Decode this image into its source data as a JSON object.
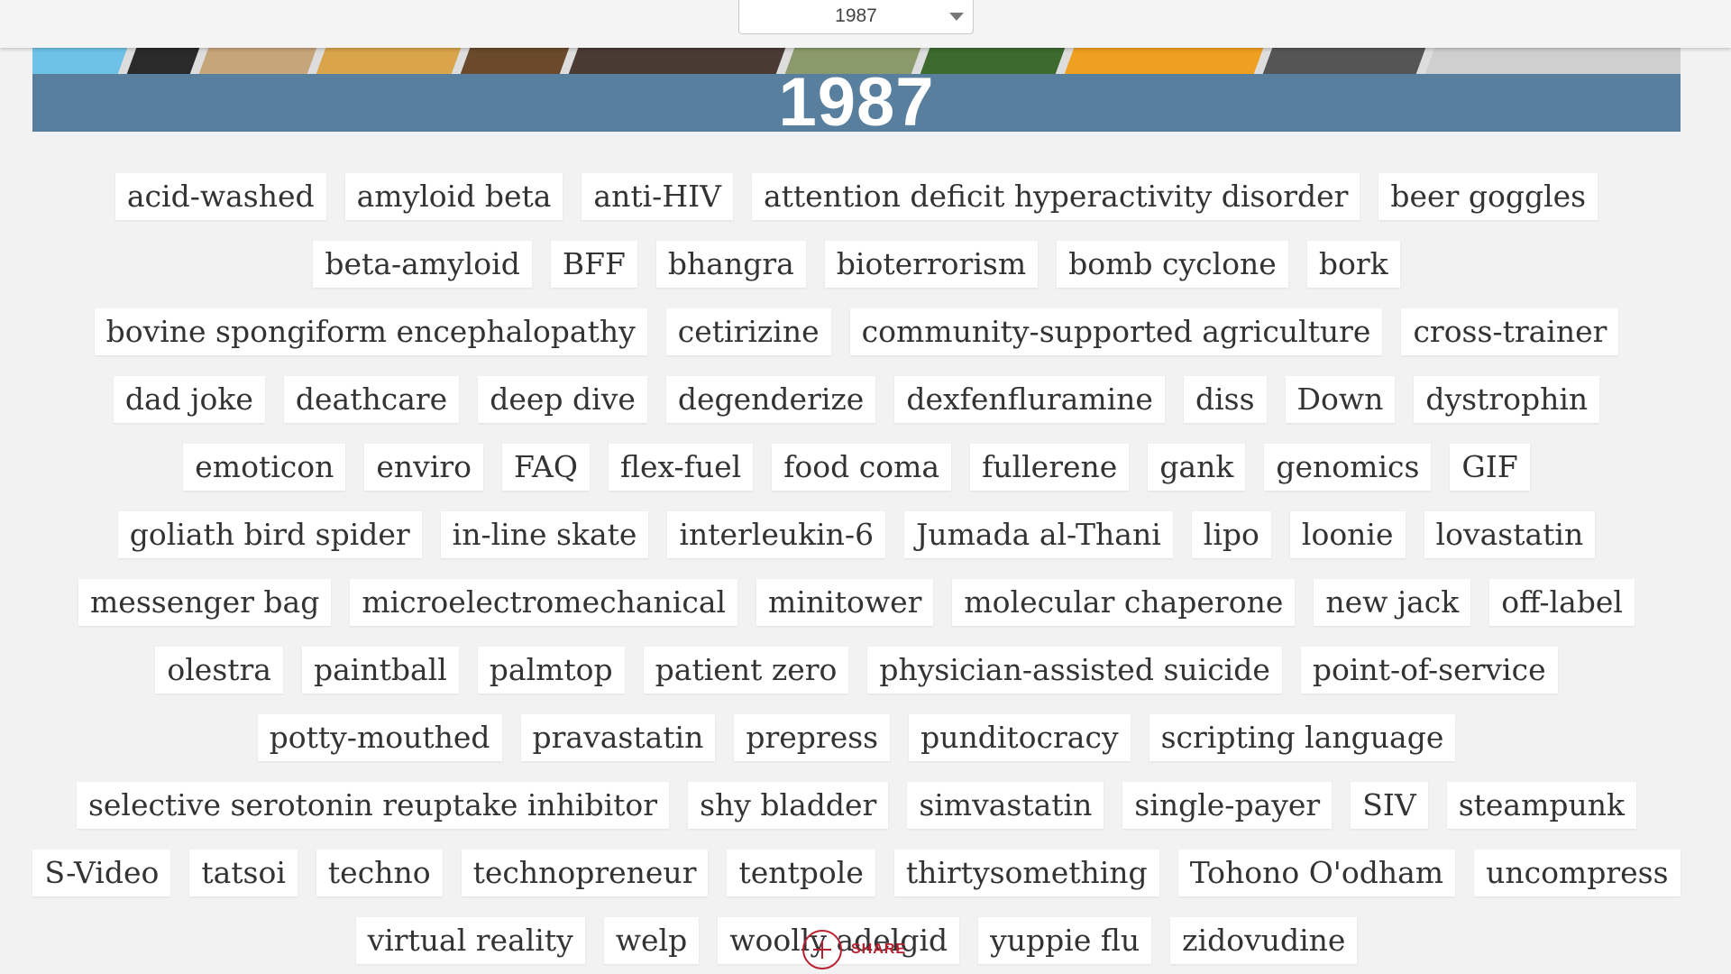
{
  "year_select": {
    "value": "1987"
  },
  "banner": {
    "year": "1987",
    "color": "#587f9e"
  },
  "words": [
    "acid-washed",
    "amyloid beta",
    "anti-HIV",
    "attention deficit hyperactivity disorder",
    "beer goggles",
    "beta-amyloid",
    "BFF",
    "bhangra",
    "bioterrorism",
    "bomb cyclone",
    "bork",
    "bovine spongiform encephalopathy",
    "cetirizine",
    "community-supported agriculture",
    "cross-trainer",
    "dad joke",
    "deathcare",
    "deep dive",
    "degenderize",
    "dexfenfluramine",
    "diss",
    "Down",
    "dystrophin",
    "emoticon",
    "enviro",
    "FAQ",
    "flex-fuel",
    "food coma",
    "fullerene",
    "gank",
    "genomics",
    "GIF",
    "goliath bird spider",
    "in-line skate",
    "interleukin-6",
    "Jumada al-Thani",
    "lipo",
    "loonie",
    "lovastatin",
    "messenger bag",
    "microelectromechanical",
    "minitower",
    "molecular chaperone",
    "new jack",
    "off-label",
    "olestra",
    "paintball",
    "palmtop",
    "patient zero",
    "physician-assisted suicide",
    "point-of-service",
    "potty-mouthed",
    "pravastatin",
    "prepress",
    "punditocracy",
    "scripting language",
    "selective serotonin reuptake inhibitor",
    "shy bladder",
    "simvastatin",
    "single-payer",
    "SIV",
    "steampunk",
    "S-Video",
    "tatsoi",
    "techno",
    "technopreneur",
    "tentpole",
    "thirtysomething",
    "Tohono O'odham",
    "uncompress",
    "virtual reality",
    "welp",
    "woolly adelgid",
    "yuppie flu",
    "zidovudine"
  ],
  "rows": [
    6,
    7,
    6,
    10,
    9,
    6,
    7,
    5,
    7,
    7,
    5
  ],
  "share": {
    "label": "SHARE",
    "icon": "plus-circle-icon",
    "color": "#b8202f"
  }
}
